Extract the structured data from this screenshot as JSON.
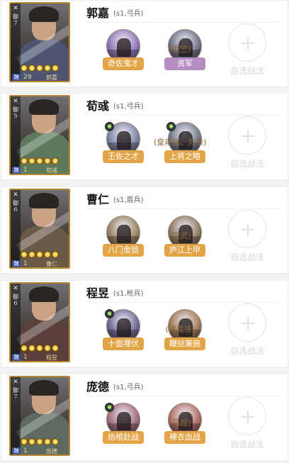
{
  "generals": [
    {
      "name": "郭嘉",
      "info": "(s1,弓兵)",
      "portrait": {
        "cost": "御7",
        "cost_num": "7",
        "level": "29",
        "hero_name": "郭嘉",
        "faction": "魏",
        "stars": 5,
        "tint": "#4e5572"
      },
      "skills": [
        {
          "name": "奇佐鬼才",
          "label_color": "orange",
          "icon_tint": "#8d78b8",
          "source": ""
        },
        {
          "name": "资军",
          "label_color": "purple",
          "icon_tint": "#6d7488",
          "source": "(糜竺)"
        }
      ],
      "add_label": "自选战法"
    },
    {
      "name": "荀彧",
      "info": "(s1,弓兵)",
      "portrait": {
        "cost": "御5",
        "cost_num": "5",
        "level": "1",
        "hero_name": "荀彧",
        "faction": "魏",
        "stars": 5,
        "tint": "#5d7a5c"
      },
      "skills": [
        {
          "name": "王佐之才",
          "label_color": "orange",
          "icon_tint": "#7b86a6",
          "source": ""
        },
        {
          "name": "上将之略",
          "label_color": "orange",
          "icon_tint": "#6e7a88",
          "source": "(皇甫嵩、刘表)"
        }
      ],
      "add_label": "自选战法"
    },
    {
      "name": "曹仁",
      "info": "(s1,盾兵)",
      "portrait": {
        "cost": "御6",
        "cost_num": "6",
        "level": "1",
        "hero_name": "曹仁",
        "faction": "魏",
        "stars": 5,
        "tint": "#6a5a48"
      },
      "skills": [
        {
          "name": "八门金锁",
          "label_color": "orange",
          "icon_tint": "#9a8566",
          "source": ""
        },
        {
          "name": "庐江上甲",
          "label_color": "orange",
          "icon_tint": "#8e7b64",
          "source": "(陈武)"
        }
      ],
      "add_label": "自选战法"
    },
    {
      "name": "程昱",
      "info": "(s1,枪兵)",
      "portrait": {
        "cost": "御6",
        "cost_num": "6",
        "level": "1",
        "hero_name": "程昱",
        "faction": "魏",
        "stars": 5,
        "tint": "#5a3f3a"
      },
      "skills": [
        {
          "name": "十面埋伏",
          "label_color": "orange",
          "icon_tint": "#6e6a96",
          "source": ""
        },
        {
          "name": "鞭挞兼施",
          "label_color": "orange",
          "icon_tint": "#a07a58",
          "source": "(诸葛恪)"
        }
      ],
      "add_label": "自选战法"
    },
    {
      "name": "庞德",
      "info": "(s1,弓兵)",
      "portrait": {
        "cost": "御7",
        "cost_num": "7",
        "level": "1",
        "hero_name": "庞德",
        "faction": "魏",
        "stars": 5,
        "tint": "#5c6a60"
      },
      "skills": [
        {
          "name": "抬棺赴战",
          "label_color": "orange",
          "icon_tint": "#a46e80",
          "source": ""
        },
        {
          "name": "裸衣血战",
          "label_color": "orange",
          "icon_tint": "#b06e66",
          "source": "(马超)"
        }
      ],
      "add_label": "自选战法"
    }
  ]
}
